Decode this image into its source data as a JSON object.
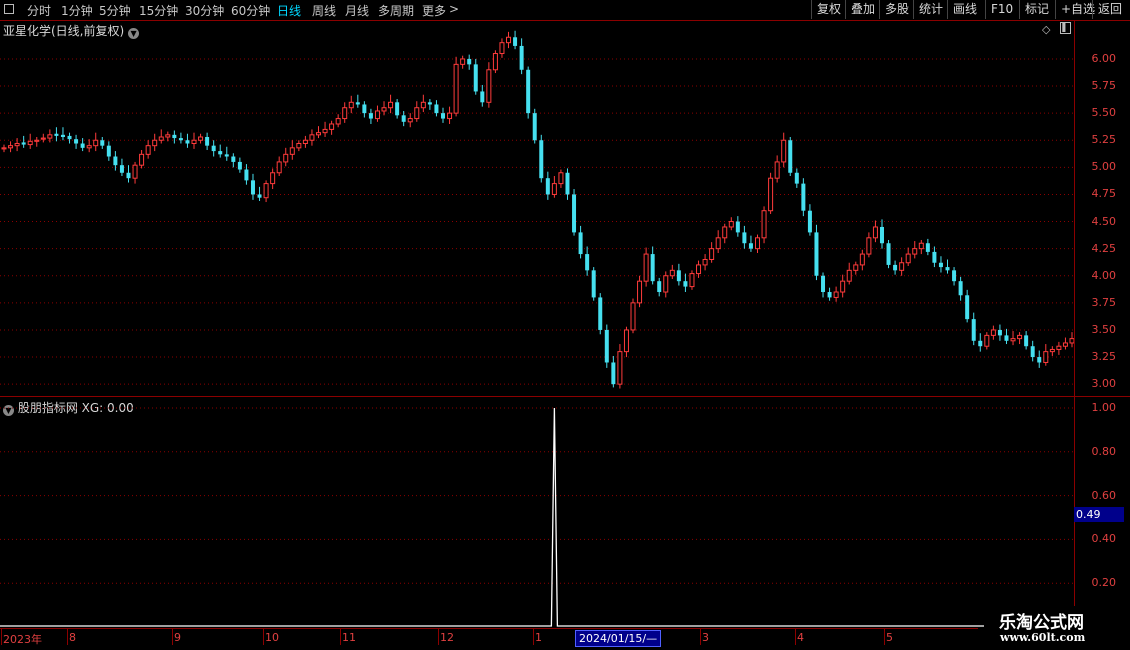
{
  "toolbar": {
    "periods": [
      {
        "label": "分时",
        "active": false
      },
      {
        "label": "1分钟",
        "active": false
      },
      {
        "label": "5分钟",
        "active": false
      },
      {
        "label": "15分钟",
        "active": false
      },
      {
        "label": "30分钟",
        "active": false
      },
      {
        "label": "60分钟",
        "active": false
      },
      {
        "label": "日线",
        "active": true
      },
      {
        "label": "周线",
        "active": false
      },
      {
        "label": "月线",
        "active": false
      },
      {
        "label": "多周期",
        "active": false
      },
      {
        "label": "更多",
        "active": false
      }
    ],
    "more_arrow": ">",
    "right_buttons": [
      "复权",
      "叠加",
      "多股",
      "统计",
      "画线",
      "F10",
      "标记",
      "+自选",
      "返回"
    ]
  },
  "price_pane": {
    "title": "亚星化学(日线,前复权)",
    "axis_labels": [
      "6.00",
      "5.75",
      "5.50",
      "5.25",
      "5.00",
      "4.75",
      "4.50",
      "4.25",
      "4.00",
      "3.75",
      "3.50",
      "3.25",
      "3.00"
    ]
  },
  "indicator_pane": {
    "title": "股朋指标网 XG: 0.00",
    "axis_labels": [
      "1.00",
      "0.80",
      "0.60",
      "0.40",
      "0.20"
    ],
    "current_value": "0.49"
  },
  "date_axis": {
    "labels": [
      "2023年",
      "8",
      "9",
      "10",
      "11",
      "12",
      "1",
      "3",
      "4",
      "5"
    ],
    "cursor_label": "2024/01/15/—"
  },
  "watermark": {
    "line1": "乐淘公式网",
    "line2": "www.60lt.com"
  },
  "colors": {
    "up": "#ff3b3b",
    "down": "#46e0f0",
    "axis": "#e04040",
    "grid": "#8b0000",
    "signal": "#ffffff"
  },
  "chart_data": [
    {
      "type": "candlestick",
      "title": "亚星化学(日线,前复权)",
      "ylim": [
        2.9,
        6.35
      ],
      "y_ticks": [
        6.0,
        5.75,
        5.5,
        5.25,
        5.0,
        4.75,
        4.5,
        4.25,
        4.0,
        3.75,
        3.5,
        3.25,
        3.0
      ],
      "series": [
        {
          "key": "close",
          "values": [
            5.18,
            5.2,
            5.22,
            5.21,
            5.24,
            5.25,
            5.27,
            5.3,
            5.29,
            5.28,
            5.26,
            5.22,
            5.18,
            5.2,
            5.25,
            5.2,
            5.1,
            5.02,
            4.95,
            4.9,
            5.02,
            5.12,
            5.2,
            5.25,
            5.28,
            5.3,
            5.27,
            5.25,
            5.22,
            5.25,
            5.28,
            5.2,
            5.15,
            5.12,
            5.1,
            5.05,
            4.98,
            4.88,
            4.75,
            4.72,
            4.85,
            4.95,
            5.05,
            5.12,
            5.18,
            5.22,
            5.25,
            5.3,
            5.32,
            5.35,
            5.4,
            5.45,
            5.55,
            5.6,
            5.58,
            5.5,
            5.45,
            5.52,
            5.55,
            5.6,
            5.48,
            5.42,
            5.45,
            5.55,
            5.6,
            5.58,
            5.5,
            5.45,
            5.5,
            5.95,
            6.0,
            5.95,
            5.7,
            5.6,
            5.9,
            6.05,
            6.15,
            6.2,
            6.12,
            5.9,
            5.5,
            5.25,
            4.9,
            4.75,
            4.85,
            4.95,
            4.75,
            4.4,
            4.2,
            4.05,
            3.8,
            3.5,
            3.2,
            3.0,
            3.3,
            3.5,
            3.75,
            3.95,
            4.2,
            3.95,
            3.85,
            4.0,
            4.05,
            3.95,
            3.9,
            4.02,
            4.1,
            4.15,
            4.25,
            4.35,
            4.45,
            4.5,
            4.4,
            4.3,
            4.25,
            4.35,
            4.6,
            4.9,
            5.05,
            5.25,
            4.95,
            4.85,
            4.6,
            4.4,
            4.0,
            3.85,
            3.8,
            3.85,
            3.95,
            4.05,
            4.1,
            4.2,
            4.35,
            4.45,
            4.3,
            4.1,
            4.05,
            4.12,
            4.2,
            4.25,
            4.3,
            4.22,
            4.12,
            4.08,
            4.05,
            3.95,
            3.82,
            3.6,
            3.4,
            3.35,
            3.45,
            3.5,
            3.45,
            3.4,
            3.42,
            3.45,
            3.35,
            3.25,
            3.2,
            3.3,
            3.32,
            3.35,
            3.38,
            3.42
          ],
          "name": ""
        },
        {
          "key": "open",
          "values": [
            5.17,
            5.18,
            5.2,
            5.23,
            5.21,
            5.24,
            5.26,
            5.27,
            5.31,
            5.3,
            5.29,
            5.26,
            5.22,
            5.18,
            5.2,
            5.25,
            5.2,
            5.1,
            5.02,
            4.95,
            4.9,
            5.02,
            5.12,
            5.2,
            5.25,
            5.28,
            5.3,
            5.27,
            5.25,
            5.22,
            5.25,
            5.28,
            5.2,
            5.15,
            5.12,
            5.1,
            5.05,
            4.98,
            4.88,
            4.75,
            4.72,
            4.85,
            4.95,
            5.05,
            5.12,
            5.18,
            5.22,
            5.25,
            5.3,
            5.32,
            5.35,
            5.4,
            5.45,
            5.55,
            5.6,
            5.58,
            5.5,
            5.45,
            5.52,
            5.55,
            5.6,
            5.48,
            5.42,
            5.45,
            5.55,
            5.6,
            5.58,
            5.5,
            5.45,
            5.5,
            5.95,
            6.0,
            5.95,
            5.7,
            5.6,
            5.9,
            6.05,
            6.15,
            6.2,
            6.12,
            5.9,
            5.5,
            5.25,
            4.9,
            4.75,
            4.85,
            4.95,
            4.75,
            4.4,
            4.2,
            4.05,
            3.8,
            3.5,
            3.2,
            3.0,
            3.3,
            3.5,
            3.75,
            3.95,
            4.2,
            3.95,
            3.85,
            4.0,
            4.05,
            3.95,
            3.9,
            4.02,
            4.1,
            4.15,
            4.25,
            4.35,
            4.45,
            4.5,
            4.4,
            4.3,
            4.25,
            4.35,
            4.6,
            4.9,
            5.05,
            5.25,
            4.95,
            4.85,
            4.6,
            4.4,
            4.0,
            3.85,
            3.8,
            3.85,
            3.95,
            4.05,
            4.1,
            4.2,
            4.35,
            4.45,
            4.3,
            4.1,
            4.05,
            4.12,
            4.2,
            4.25,
            4.3,
            4.22,
            4.12,
            4.08,
            4.05,
            3.95,
            3.82,
            3.6,
            3.4,
            3.35,
            3.45,
            3.5,
            3.45,
            3.4,
            3.42,
            3.45,
            3.35,
            3.25,
            3.2,
            3.3,
            3.32,
            3.35,
            3.38
          ],
          "name": ""
        }
      ],
      "price_range": {
        "low": 2.95,
        "high": 6.3
      }
    },
    {
      "type": "line",
      "title": "股朋指标网 XG: 0.00",
      "ylim": [
        0.0,
        1.05
      ],
      "y_ticks": [
        1.0,
        0.8,
        0.6,
        0.4,
        0.2
      ],
      "series": [
        {
          "name": "XG",
          "spike_index": 84,
          "spike_value": 1.0,
          "baseline": 0.0
        }
      ]
    }
  ]
}
